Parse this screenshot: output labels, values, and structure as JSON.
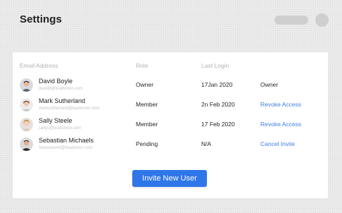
{
  "page": {
    "title": "Settings"
  },
  "table": {
    "headers": {
      "email": "Email Address",
      "role": "Role",
      "last_login": "Last Login"
    },
    "rows": [
      {
        "name": "David Boyle",
        "email": "davidb@leadsmen.com",
        "role": "Owner",
        "last_login": "17Jan 2020",
        "action": "Owner",
        "action_is_link": false
      },
      {
        "name": "Mark Sutherland",
        "email": "marksutherland@leadsmen.com",
        "role": "Member",
        "last_login": "2n Feb 2020",
        "action": "Revoke Access",
        "action_is_link": true
      },
      {
        "name": "Sally Steele",
        "email": "sallys@leadsmen.com",
        "role": "Member",
        "last_login": "17 Feb 2020",
        "action": "Revoke Access",
        "action_is_link": true
      },
      {
        "name": "Sebastian Michaels",
        "email": "Sebastianm@leadsmen.com",
        "role": "Pending",
        "last_login": "N/A",
        "action": "Cancel Invite",
        "action_is_link": true
      }
    ]
  },
  "invite_button": {
    "label": "Invite New User"
  },
  "colors": {
    "accent": "#2f76e8",
    "link": "#3d7fe6",
    "background": "#ebebeb",
    "card": "#ffffff"
  }
}
